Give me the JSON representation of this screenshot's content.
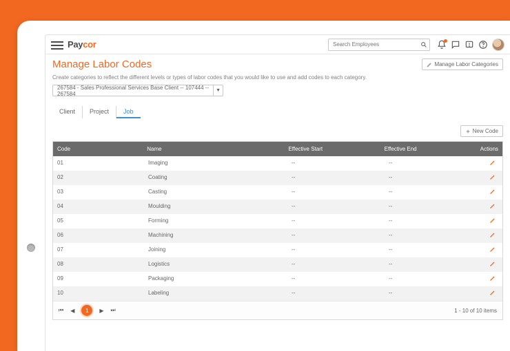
{
  "header": {
    "logo_prefix": "Pay",
    "logo_suffix": "cor",
    "search_placeholder": "Search Employees"
  },
  "page": {
    "title": "Manage Labor Codes",
    "manage_categories_label": "Manage Labor Categories",
    "subtitle": "Create categories to reflect the different levels or types of labor codes that you would like to use and add codes to each category.",
    "client_select": "267584 - Sales Professional Services Base Client -- 107444 -- 267584"
  },
  "tabs": [
    {
      "label": "Client",
      "active": false
    },
    {
      "label": "Project",
      "active": false
    },
    {
      "label": "Job",
      "active": true
    }
  ],
  "buttons": {
    "new_code": "New Code"
  },
  "table": {
    "headers": {
      "code": "Code",
      "name": "Name",
      "start": "Effective Start",
      "end": "Effective End",
      "actions": "Actions"
    },
    "rows": [
      {
        "code": "01",
        "name": "Imaging",
        "start": "--",
        "end": "--"
      },
      {
        "code": "02",
        "name": "Coating",
        "start": "--",
        "end": "--"
      },
      {
        "code": "03",
        "name": "Casting",
        "start": "--",
        "end": "--"
      },
      {
        "code": "04",
        "name": "Moulding",
        "start": "--",
        "end": "--"
      },
      {
        "code": "05",
        "name": "Forming",
        "start": "--",
        "end": "--"
      },
      {
        "code": "06",
        "name": "Machining",
        "start": "--",
        "end": "--"
      },
      {
        "code": "07",
        "name": "Joining",
        "start": "--",
        "end": "--"
      },
      {
        "code": "08",
        "name": "Logistics",
        "start": "--",
        "end": "--"
      },
      {
        "code": "09",
        "name": "Packaging",
        "start": "--",
        "end": "--"
      },
      {
        "code": "10",
        "name": "Labeling",
        "start": "--",
        "end": "--"
      }
    ]
  },
  "pager": {
    "current": "1",
    "summary": "1 - 10 of 10 items"
  }
}
